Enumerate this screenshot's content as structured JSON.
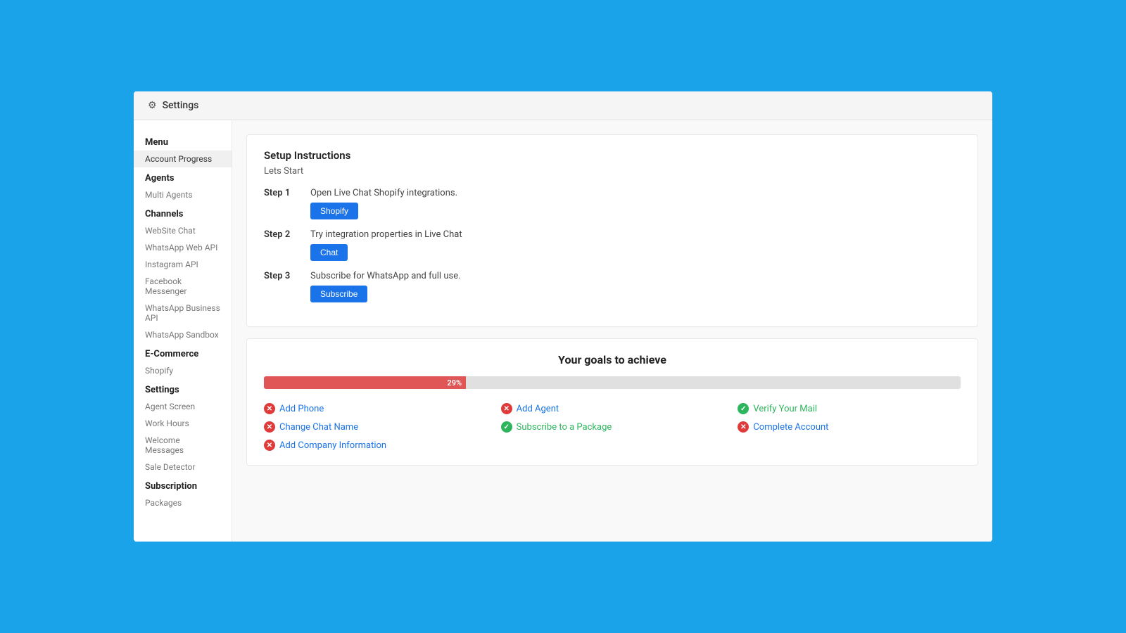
{
  "topBar": {
    "iconLabel": "⚙",
    "title": "Settings"
  },
  "sidebar": {
    "sections": [
      {
        "header": "Menu",
        "items": [
          {
            "label": "Account Progress",
            "active": true
          }
        ]
      },
      {
        "header": "Agents",
        "items": [
          {
            "label": "Multi Agents",
            "active": false
          }
        ]
      },
      {
        "header": "Channels",
        "items": [
          {
            "label": "WebSite Chat",
            "active": false
          },
          {
            "label": "WhatsApp Web API",
            "active": false
          },
          {
            "label": "Instagram API",
            "active": false
          },
          {
            "label": "Facebook Messenger",
            "active": false
          },
          {
            "label": "WhatsApp Business API",
            "active": false
          },
          {
            "label": "WhatsApp Sandbox",
            "active": false
          }
        ]
      },
      {
        "header": "E-Commerce",
        "items": [
          {
            "label": "Shopify",
            "active": false
          }
        ]
      },
      {
        "header": "Settings",
        "items": [
          {
            "label": "Agent Screen",
            "active": false
          },
          {
            "label": "Work Hours",
            "active": false
          },
          {
            "label": "Welcome Messages",
            "active": false
          },
          {
            "label": "Sale Detector",
            "active": false
          }
        ]
      },
      {
        "header": "Subscription",
        "items": [
          {
            "label": "Packages",
            "active": false
          }
        ]
      }
    ]
  },
  "setupInstructions": {
    "title": "Setup Instructions",
    "subtitle": "Lets Start",
    "steps": [
      {
        "label": "Step 1",
        "description": "Open Live Chat Shopify integrations.",
        "buttonLabel": "Shopify"
      },
      {
        "label": "Step 2",
        "description": "Try integration properties in Live Chat",
        "buttonLabel": "Chat"
      },
      {
        "label": "Step 3",
        "description": "Subscribe for WhatsApp and full use.",
        "buttonLabel": "Subscribe"
      }
    ]
  },
  "goals": {
    "title": "Your goals to achieve",
    "progress": 29,
    "progressLabel": "29%",
    "items": [
      {
        "label": "Add Phone",
        "status": "error",
        "col": 1,
        "row": 1
      },
      {
        "label": "Add Agent",
        "status": "error",
        "col": 2,
        "row": 1
      },
      {
        "label": "Verify Your Mail",
        "status": "success",
        "col": 3,
        "row": 1
      },
      {
        "label": "Change Chat Name",
        "status": "error",
        "col": 1,
        "row": 2
      },
      {
        "label": "Subscribe to a Package",
        "status": "success",
        "col": 2,
        "row": 2
      },
      {
        "label": "Complete Account",
        "status": "error",
        "col": 3,
        "row": 2
      },
      {
        "label": "Add Company Information",
        "status": "error",
        "col": 1,
        "row": 3
      }
    ]
  }
}
